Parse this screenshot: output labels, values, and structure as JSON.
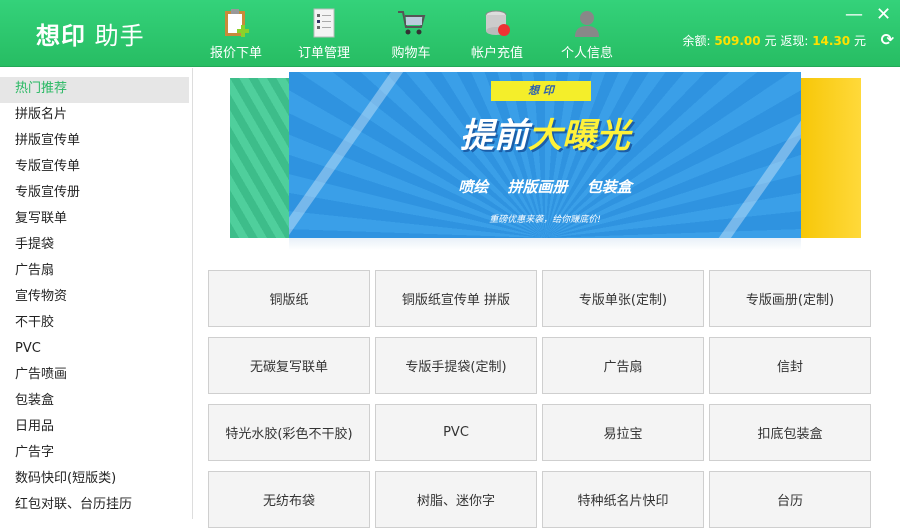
{
  "app": {
    "logo_bold": "想印",
    "logo_rest": " 助手"
  },
  "nav": [
    {
      "label": "报价下单",
      "icon": "clipboard-add-icon"
    },
    {
      "label": "订单管理",
      "icon": "checklist-icon"
    },
    {
      "label": "购物车",
      "icon": "cart-icon"
    },
    {
      "label": "帐户充值",
      "icon": "database-icon"
    },
    {
      "label": "个人信息",
      "icon": "user-icon"
    }
  ],
  "window": {
    "minimize": "—",
    "close": "✕"
  },
  "balance": {
    "label": "余额:",
    "value": "509.00",
    "unit": "元",
    "cashback_label": "返现:",
    "cashback_value": "14.30",
    "cashback_unit": "元",
    "refresh": "⟳"
  },
  "sidebar": [
    "热门推荐",
    "拼版名片",
    "拼版宣传单",
    "专版宣传单",
    "专版宣传册",
    "复写联单",
    "手提袋",
    "广告扇",
    "宣传物资",
    "不干胶",
    "PVC",
    "广告喷画",
    "包装盒",
    "日用品",
    "广告字",
    "数码快印(短版类)",
    "红包对联、台历挂历"
  ],
  "banner": {
    "ribbon": "想 印",
    "headline_white": "提前",
    "headline_yellow": "大曝光",
    "categories": "喷绘 拼版画册 包装盒",
    "slogan": "重磅优惠来袭，给你赚底价!"
  },
  "products": [
    "铜版纸",
    "铜版纸宣传单 拼版",
    "专版单张(定制)",
    "专版画册(定制)",
    "无碳复写联单",
    "专版手提袋(定制)",
    "广告扇",
    "信封",
    "特光水胶(彩色不干胶)",
    "PVC",
    "易拉宝",
    "扣底包装盒",
    "无纺布袋",
    "树脂、迷你字",
    "特种纸名片快印",
    "台历"
  ]
}
